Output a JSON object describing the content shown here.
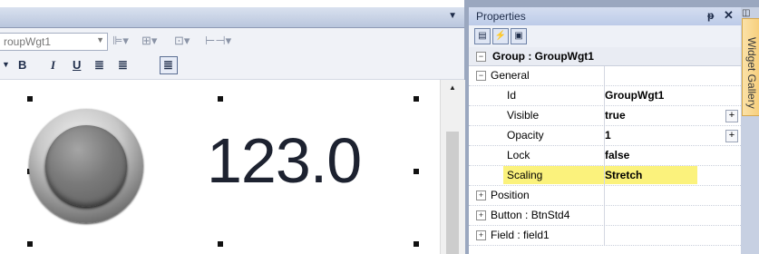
{
  "editor": {
    "widget_selector": "roupWgt1",
    "canvas_value": "123.0",
    "format": {
      "bold": "B",
      "italic": "I",
      "underline": "U"
    }
  },
  "properties": {
    "title": "Properties",
    "group_header": "Group : GroupWgt1",
    "general": {
      "label": "General",
      "rows": [
        {
          "label": "Id",
          "value": "GroupWgt1"
        },
        {
          "label": "Visible",
          "value": "true"
        },
        {
          "label": "Opacity",
          "value": "1"
        },
        {
          "label": "Lock",
          "value": "false"
        },
        {
          "label": "Scaling",
          "value": "Stretch"
        }
      ]
    },
    "categories": [
      "Position",
      "Button : BtnStd4",
      "Field : field1"
    ],
    "highlight_color": "#fbf27c"
  },
  "sidebar": {
    "widget_gallery": "Widget Gallery"
  }
}
